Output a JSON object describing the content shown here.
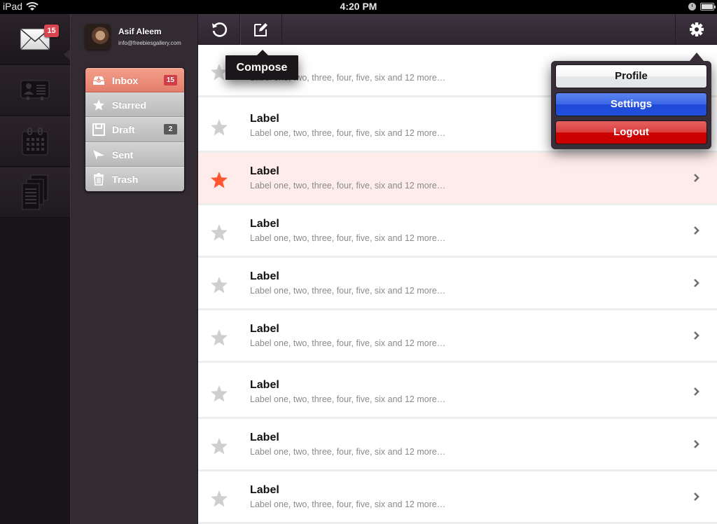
{
  "status_bar": {
    "carrier": "iPad",
    "time": "4:20 PM",
    "icons": [
      "wifi-icon",
      "clock-icon",
      "battery-icon"
    ]
  },
  "rail": {
    "items": [
      {
        "name": "mail",
        "icon": "envelope-icon",
        "badge": "15",
        "active": true
      },
      {
        "name": "contacts",
        "icon": "contact-card-icon"
      },
      {
        "name": "calendar",
        "icon": "calendar-icon"
      },
      {
        "name": "documents",
        "icon": "documents-icon"
      }
    ]
  },
  "account": {
    "name": "Asif Aleem",
    "email": "info@freebiesgallery.com"
  },
  "folders": [
    {
      "label": "Inbox",
      "icon": "inbox-icon",
      "badge": "15",
      "active": true
    },
    {
      "label": "Starred",
      "icon": "star-icon"
    },
    {
      "label": "Draft",
      "icon": "floppy-disk-icon",
      "badge": "2"
    },
    {
      "label": "Sent",
      "icon": "paper-plane-icon"
    },
    {
      "label": "Trash",
      "icon": "trash-icon"
    }
  ],
  "toolbar": {
    "refresh_icon": "refresh-icon",
    "compose_icon": "compose-icon",
    "settings_icon": "gear-icon"
  },
  "tooltip": {
    "text": "Compose"
  },
  "popover": {
    "profile_label": "Profile",
    "settings_label": "Settings",
    "logout_label": "Logout"
  },
  "colors": {
    "accent_star": "#ff5630",
    "highlight_row": "#fdecea",
    "badge_red": "#d9454f",
    "settings_blue": "#2150dc",
    "logout_red": "#cc0000"
  },
  "messages": [
    {
      "subject": "Label",
      "preview": "Label one, two, three, four, five, six and 12 more…",
      "starred": false
    },
    {
      "subject": "Label",
      "preview": "Label one, two, three, four, five, six and 12 more…",
      "starred": false
    },
    {
      "subject": "Label",
      "preview": "Label one, two, three, four, five, six and 12 more…",
      "starred": true,
      "highlighted": true
    },
    {
      "subject": "Label",
      "preview": "Label one, two, three, four, five, six and 12 more…",
      "starred": false
    },
    {
      "subject": "Label",
      "preview": "Label one, two, three, four, five, six and 12 more…",
      "starred": false
    },
    {
      "subject": "Label",
      "preview": "Label one, two, three, four, five, six and 12 more…",
      "starred": false
    },
    {
      "subject": "Label",
      "preview": "Label one, two, three, four, five, six and 12 more…",
      "starred": false
    },
    {
      "subject": "Label",
      "preview": "Label one, two, three, four, five, six and 12 more…",
      "starred": false
    },
    {
      "subject": "Label",
      "preview": "Label one, two, three, four, five, six and 12 more…",
      "starred": false
    }
  ]
}
